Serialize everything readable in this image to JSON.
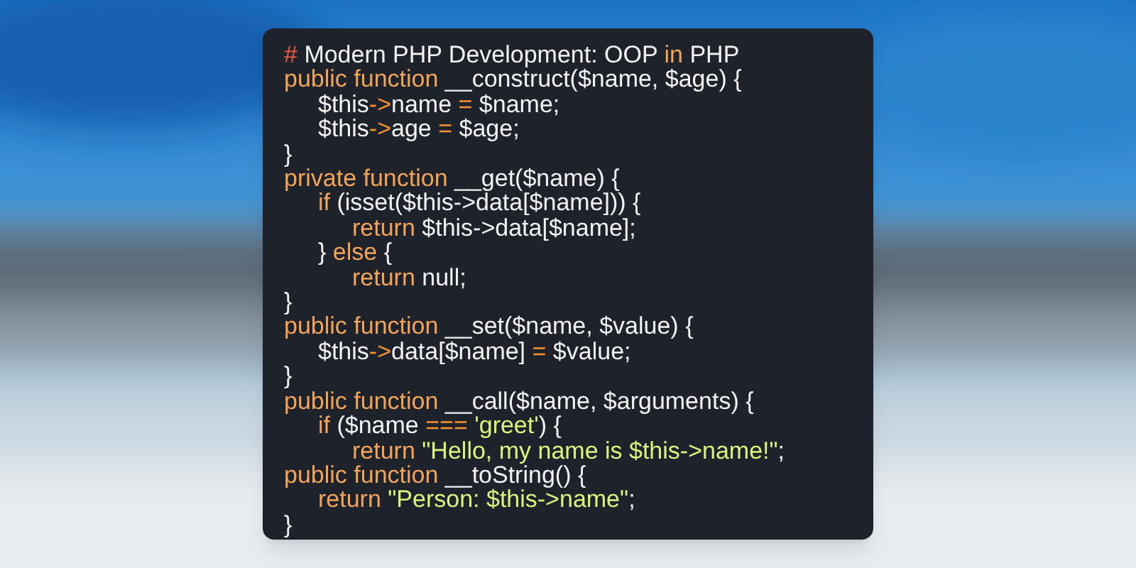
{
  "code": {
    "lines": [
      {
        "tokens": [
          {
            "kind": "hash",
            "text": "#"
          },
          {
            "kind": "plain",
            "text": " Modern PHP Development: OOP "
          },
          {
            "kind": "keyword",
            "text": "in"
          },
          {
            "kind": "plain",
            "text": " PHP"
          }
        ]
      },
      {
        "tokens": [
          {
            "kind": "keyword",
            "text": "public function"
          },
          {
            "kind": "plain",
            "text": " __construct($name, $age) {"
          }
        ],
        "children": [
          {
            "tokens": [
              {
                "kind": "plain",
                "text": "$this"
              },
              {
                "kind": "operator",
                "text": "->"
              },
              {
                "kind": "plain",
                "text": "name "
              },
              {
                "kind": "operator",
                "text": "="
              },
              {
                "kind": "plain",
                "text": " $name;"
              }
            ]
          },
          {
            "tokens": [
              {
                "kind": "plain",
                "text": "$this"
              },
              {
                "kind": "operator",
                "text": "->"
              },
              {
                "kind": "plain",
                "text": "age "
              },
              {
                "kind": "operator",
                "text": "="
              },
              {
                "kind": "plain",
                "text": " $age;"
              }
            ]
          }
        ]
      },
      {
        "tokens": [
          {
            "kind": "plain",
            "text": "}"
          }
        ]
      },
      {
        "tokens": [
          {
            "kind": "keyword",
            "text": "private function"
          },
          {
            "kind": "plain",
            "text": " __get($name) {"
          }
        ],
        "children": [
          {
            "tokens": [
              {
                "kind": "keyword",
                "text": "if"
              },
              {
                "kind": "plain",
                "text": " (isset($this->data[$name])) {"
              }
            ],
            "children": [
              {
                "tokens": [
                  {
                    "kind": "keyword",
                    "text": "return"
                  },
                  {
                    "kind": "plain",
                    "text": " $this->data[$name];"
                  }
                ]
              }
            ]
          },
          {
            "tokens": [
              {
                "kind": "plain",
                "text": "} "
              },
              {
                "kind": "keyword",
                "text": "else"
              },
              {
                "kind": "plain",
                "text": " {"
              }
            ],
            "children": [
              {
                "tokens": [
                  {
                    "kind": "keyword",
                    "text": "return"
                  },
                  {
                    "kind": "plain",
                    "text": " null;"
                  }
                ]
              }
            ]
          }
        ]
      },
      {
        "tokens": [
          {
            "kind": "plain",
            "text": "}"
          }
        ]
      },
      {
        "tokens": [
          {
            "kind": "keyword",
            "text": "public function"
          },
          {
            "kind": "plain",
            "text": " __set($name, $value) {"
          }
        ],
        "children": [
          {
            "tokens": [
              {
                "kind": "plain",
                "text": "$this"
              },
              {
                "kind": "operator",
                "text": "->"
              },
              {
                "kind": "plain",
                "text": "data[$name] "
              },
              {
                "kind": "operator",
                "text": "="
              },
              {
                "kind": "plain",
                "text": " $value;"
              }
            ]
          }
        ]
      },
      {
        "tokens": [
          {
            "kind": "plain",
            "text": "}"
          }
        ]
      },
      {
        "tokens": [
          {
            "kind": "keyword",
            "text": "public function"
          },
          {
            "kind": "plain",
            "text": " __call($name, $arguments) {"
          }
        ],
        "children": [
          {
            "tokens": [
              {
                "kind": "keyword",
                "text": "if"
              },
              {
                "kind": "plain",
                "text": " ($name "
              },
              {
                "kind": "operator",
                "text": "==="
              },
              {
                "kind": "string",
                "text": " 'greet'"
              },
              {
                "kind": "plain",
                "text": ") {"
              }
            ],
            "children": [
              {
                "tokens": [
                  {
                    "kind": "keyword",
                    "text": "return"
                  },
                  {
                    "kind": "string",
                    "text": " \"Hello, my name is $this->name!\""
                  },
                  {
                    "kind": "plain",
                    "text": ";"
                  }
                ]
              }
            ]
          }
        ]
      },
      {
        "tokens": [
          {
            "kind": "keyword",
            "text": "public function"
          },
          {
            "kind": "plain",
            "text": " __toString() {"
          }
        ],
        "children": [
          {
            "tokens": [
              {
                "kind": "keyword",
                "text": "return"
              },
              {
                "kind": "string",
                "text": " \"Person: $this->name\""
              },
              {
                "kind": "plain",
                "text": ";"
              }
            ]
          }
        ]
      },
      {
        "tokens": [
          {
            "kind": "plain",
            "text": "}"
          }
        ]
      }
    ]
  }
}
